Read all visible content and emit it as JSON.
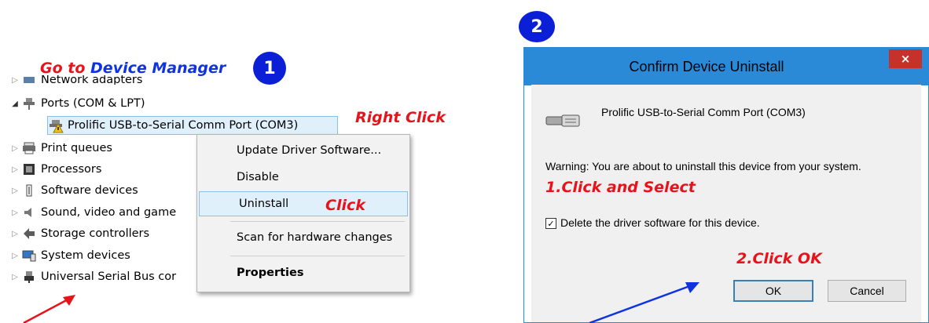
{
  "annotations": {
    "step1_badge": "1",
    "step2_badge": "2",
    "go_to_part1": "Go to",
    "go_to_part2": "Device Manager",
    "right_click": "Right Click",
    "click": "Click",
    "click_and_select": "1.Click and Select",
    "click_ok": "2.Click OK"
  },
  "device_manager": {
    "top_cut_label": "Network adapters",
    "ports_label": "Ports (COM & LPT)",
    "selected_device": "Prolific USB-to-Serial Comm Port (COM3)",
    "items": [
      "Print queues",
      "Processors",
      "Software devices",
      "Sound, video and game",
      "Storage controllers",
      "System devices",
      "Universal Serial Bus cor"
    ]
  },
  "context_menu": {
    "update": "Update Driver Software...",
    "disable": "Disable",
    "uninstall": "Uninstall",
    "scan": "Scan for hardware changes",
    "properties": "Properties"
  },
  "dialog": {
    "title": "Confirm Device Uninstall",
    "close": "×",
    "device_name": "Prolific USB-to-Serial Comm Port (COM3)",
    "warning": "Warning: You are about to uninstall this device from your system.",
    "checkbox_label": "Delete the driver software for this device.",
    "checkbox_checked": true,
    "ok": "OK",
    "cancel": "Cancel"
  },
  "colors": {
    "annotation_red": "#e8121a",
    "annotation_blue": "#1033e0",
    "badge_blue": "#0a1fd6"
  }
}
